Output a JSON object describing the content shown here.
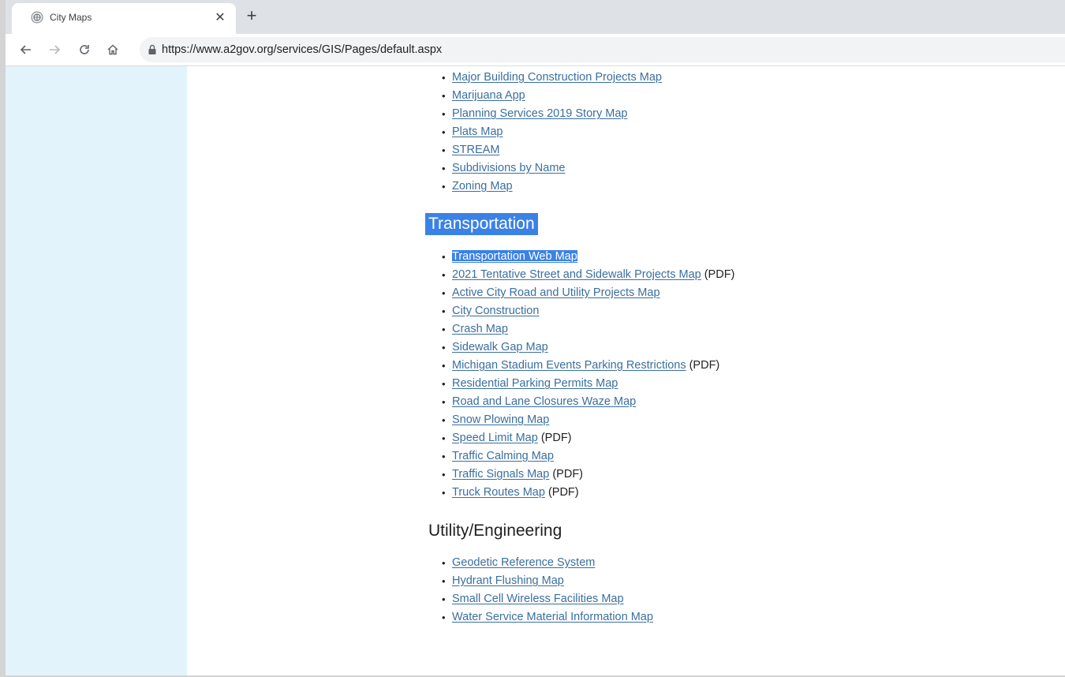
{
  "browser": {
    "tab": {
      "title": "City Maps",
      "favicon": "globe-seal-icon",
      "close_icon": "close-icon"
    },
    "new_tab_icon": "plus-icon",
    "toolbar": {
      "back_icon": "back-arrow-icon",
      "forward_icon": "forward-arrow-icon",
      "reload_icon": "reload-icon",
      "home_icon": "home-icon",
      "lock_icon": "lock-icon",
      "url": "https://www.a2gov.org/services/GIS/Pages/default.aspx"
    }
  },
  "colors": {
    "link": "#3a6f9f",
    "selection": "#3b82e6",
    "sidebar": "#e3f3fc"
  },
  "sections": [
    {
      "heading": "",
      "items": [
        {
          "label": "Major Building Construction Projects Map",
          "suffix": ""
        },
        {
          "label": "Marijuana App",
          "suffix": ""
        },
        {
          "label": "Planning Services 2019 Story Map",
          "suffix": ""
        },
        {
          "label": "Plats Map",
          "suffix": ""
        },
        {
          "label": "STREAM",
          "suffix": ""
        },
        {
          "label": "Subdivisions by Name",
          "suffix": ""
        },
        {
          "label": "Zoning Map",
          "suffix": ""
        }
      ]
    },
    {
      "heading": "Transportation",
      "items": [
        {
          "label": "Transportation Web Map",
          "suffix": ""
        },
        {
          "label": "2021 Tentative Street and Sidewalk Projects Map",
          "suffix": " (PDF)"
        },
        {
          "label": "Active City Road and Utility Projects Map",
          "suffix": ""
        },
        {
          "label": "City Construction",
          "suffix": ""
        },
        {
          "label": "Crash Map",
          "suffix": ""
        },
        {
          "label": "Sidewalk Gap Map",
          "suffix": ""
        },
        {
          "label": "Michigan Stadium Events Parking Restrictions",
          "suffix": " (PDF)"
        },
        {
          "label": "Residential Parking Permits Map",
          "suffix": ""
        },
        {
          "label": "Road and Lane Closures Waze Map",
          "suffix": ""
        },
        {
          "label": "Snow Plowing Map",
          "suffix": ""
        },
        {
          "label": "Speed Limit Map",
          "suffix": " (PDF)"
        },
        {
          "label": "Traffic Calming Map",
          "suffix": ""
        },
        {
          "label": "Traffic Signals Map",
          "suffix": " (PDF)"
        },
        {
          "label": "Truck Routes Map",
          "suffix": " (PDF)"
        }
      ]
    },
    {
      "heading": "Utility/Engineering",
      "items": [
        {
          "label": "Geodetic Reference System",
          "suffix": ""
        },
        {
          "label": "Hydrant Flushing Map",
          "suffix": ""
        },
        {
          "label": "Small Cell Wireless Facilities Map",
          "suffix": ""
        },
        {
          "label": "Water Service Material Information Map",
          "suffix": ""
        }
      ]
    }
  ]
}
